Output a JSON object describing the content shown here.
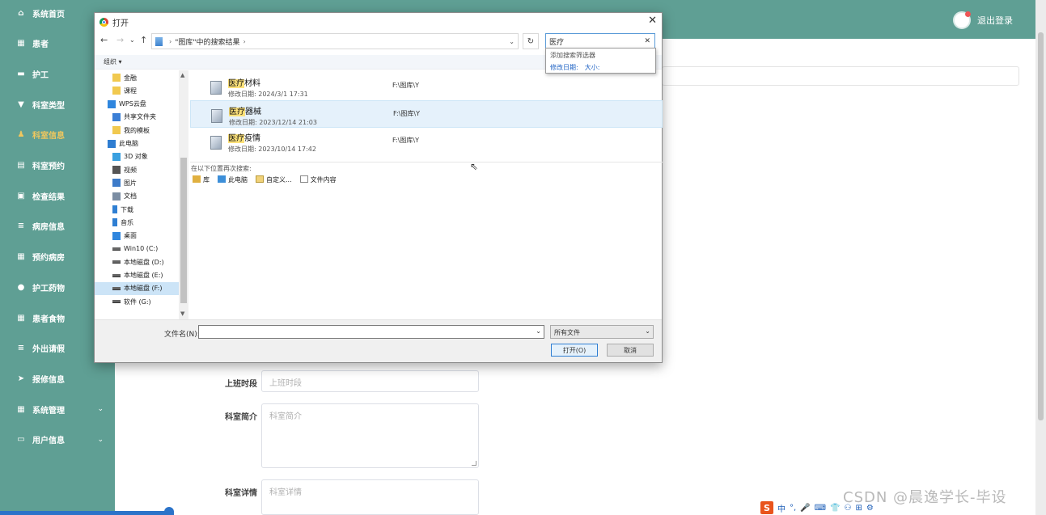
{
  "app": {
    "logout": "退出登录",
    "nav": [
      {
        "label": "系统首页",
        "icon": "home-icon",
        "glyph": "⌂"
      },
      {
        "label": "患者",
        "icon": "grid-icon",
        "glyph": "▦"
      },
      {
        "label": "护工",
        "icon": "card-icon",
        "glyph": "▬"
      },
      {
        "label": "科室类型",
        "icon": "pin-icon",
        "glyph": "▼"
      },
      {
        "label": "科室信息",
        "icon": "user-icon",
        "glyph": "♟",
        "active": true
      },
      {
        "label": "科室预约",
        "icon": "doc-icon",
        "glyph": "▤"
      },
      {
        "label": "检查结果",
        "icon": "briefcase-icon",
        "glyph": "▣"
      },
      {
        "label": "病房信息",
        "icon": "sliders-icon",
        "glyph": "≡"
      },
      {
        "label": "预约病房",
        "icon": "apps-icon",
        "glyph": "▦"
      },
      {
        "label": "护工药物",
        "icon": "location-icon",
        "glyph": "●"
      },
      {
        "label": "患者食物",
        "icon": "apps-icon",
        "glyph": "▦"
      },
      {
        "label": "外出请假",
        "icon": "list-icon",
        "glyph": "≡"
      },
      {
        "label": "报修信息",
        "icon": "send-icon",
        "glyph": "➤"
      },
      {
        "label": "系统管理",
        "icon": "apps-icon",
        "glyph": "▦",
        "chevron": "⌄"
      },
      {
        "label": "用户信息",
        "icon": "window-icon",
        "glyph": "▭",
        "chevron": "⌄"
      }
    ],
    "form": {
      "shift_label": "上班时段",
      "shift_placeholder": "上班时段",
      "intro_label": "科室简介",
      "intro_placeholder": "科室简介",
      "detail_label": "科室详情",
      "detail_placeholder": "科室详情"
    },
    "watermark": "CSDN @晨逸学长-毕设",
    "ime": [
      "中",
      "°,",
      "🎤",
      "⌨",
      "👕",
      "⚇",
      "⊞",
      "⚙"
    ]
  },
  "dialog": {
    "title": "打开",
    "address": {
      "crumb": "\"图库\"中的搜索结果"
    },
    "search_value": "医疗",
    "filter_popup": {
      "heading": "添加搜索筛选器",
      "options": [
        "修改日期:",
        "大小:"
      ]
    },
    "organize": "组织 ▾",
    "tree": [
      {
        "label": "金融",
        "kind": "folder"
      },
      {
        "label": "课程",
        "kind": "folder"
      },
      {
        "label": "WPS云盘",
        "kind": "cloud"
      },
      {
        "label": "共享文件夹",
        "kind": "share"
      },
      {
        "label": "我的模板",
        "kind": "folder"
      },
      {
        "label": "此电脑",
        "kind": "pc"
      },
      {
        "label": "3D 对象",
        "kind": "3d"
      },
      {
        "label": "视频",
        "kind": "video"
      },
      {
        "label": "图片",
        "kind": "pic"
      },
      {
        "label": "文档",
        "kind": "doc"
      },
      {
        "label": "下载",
        "kind": "down"
      },
      {
        "label": "音乐",
        "kind": "music"
      },
      {
        "label": "桌面",
        "kind": "desk"
      },
      {
        "label": "Win10 (C:)",
        "kind": "drive"
      },
      {
        "label": "本地磁盘 (D:)",
        "kind": "drive"
      },
      {
        "label": "本地磁盘 (E:)",
        "kind": "drive"
      },
      {
        "label": "本地磁盘 (F:)",
        "kind": "drive",
        "selected": true
      },
      {
        "label": "软件 (G:)",
        "kind": "drive"
      }
    ],
    "files": [
      {
        "hl": "医疗",
        "rest": "材料",
        "date": "修改日期: 2024/3/1 17:31",
        "path": "F:\\图库\\Y"
      },
      {
        "hl": "医疗",
        "rest": "器械",
        "date": "修改日期: 2023/12/14 21:03",
        "path": "F:\\图库\\Y",
        "hover": true
      },
      {
        "hl": "医疗",
        "rest": "疫情",
        "date": "修改日期: 2023/10/14 17:42",
        "path": "F:\\图库\\Y"
      }
    ],
    "search_again_label": "在以下位置再次搜索:",
    "search_again": [
      "库",
      "此电脑",
      "自定义...",
      "文件内容"
    ],
    "filename_label": "文件名(N):",
    "filename_value": "",
    "filetype": "所有文件",
    "open_button": "打开(O)",
    "cancel_button": "取消"
  }
}
